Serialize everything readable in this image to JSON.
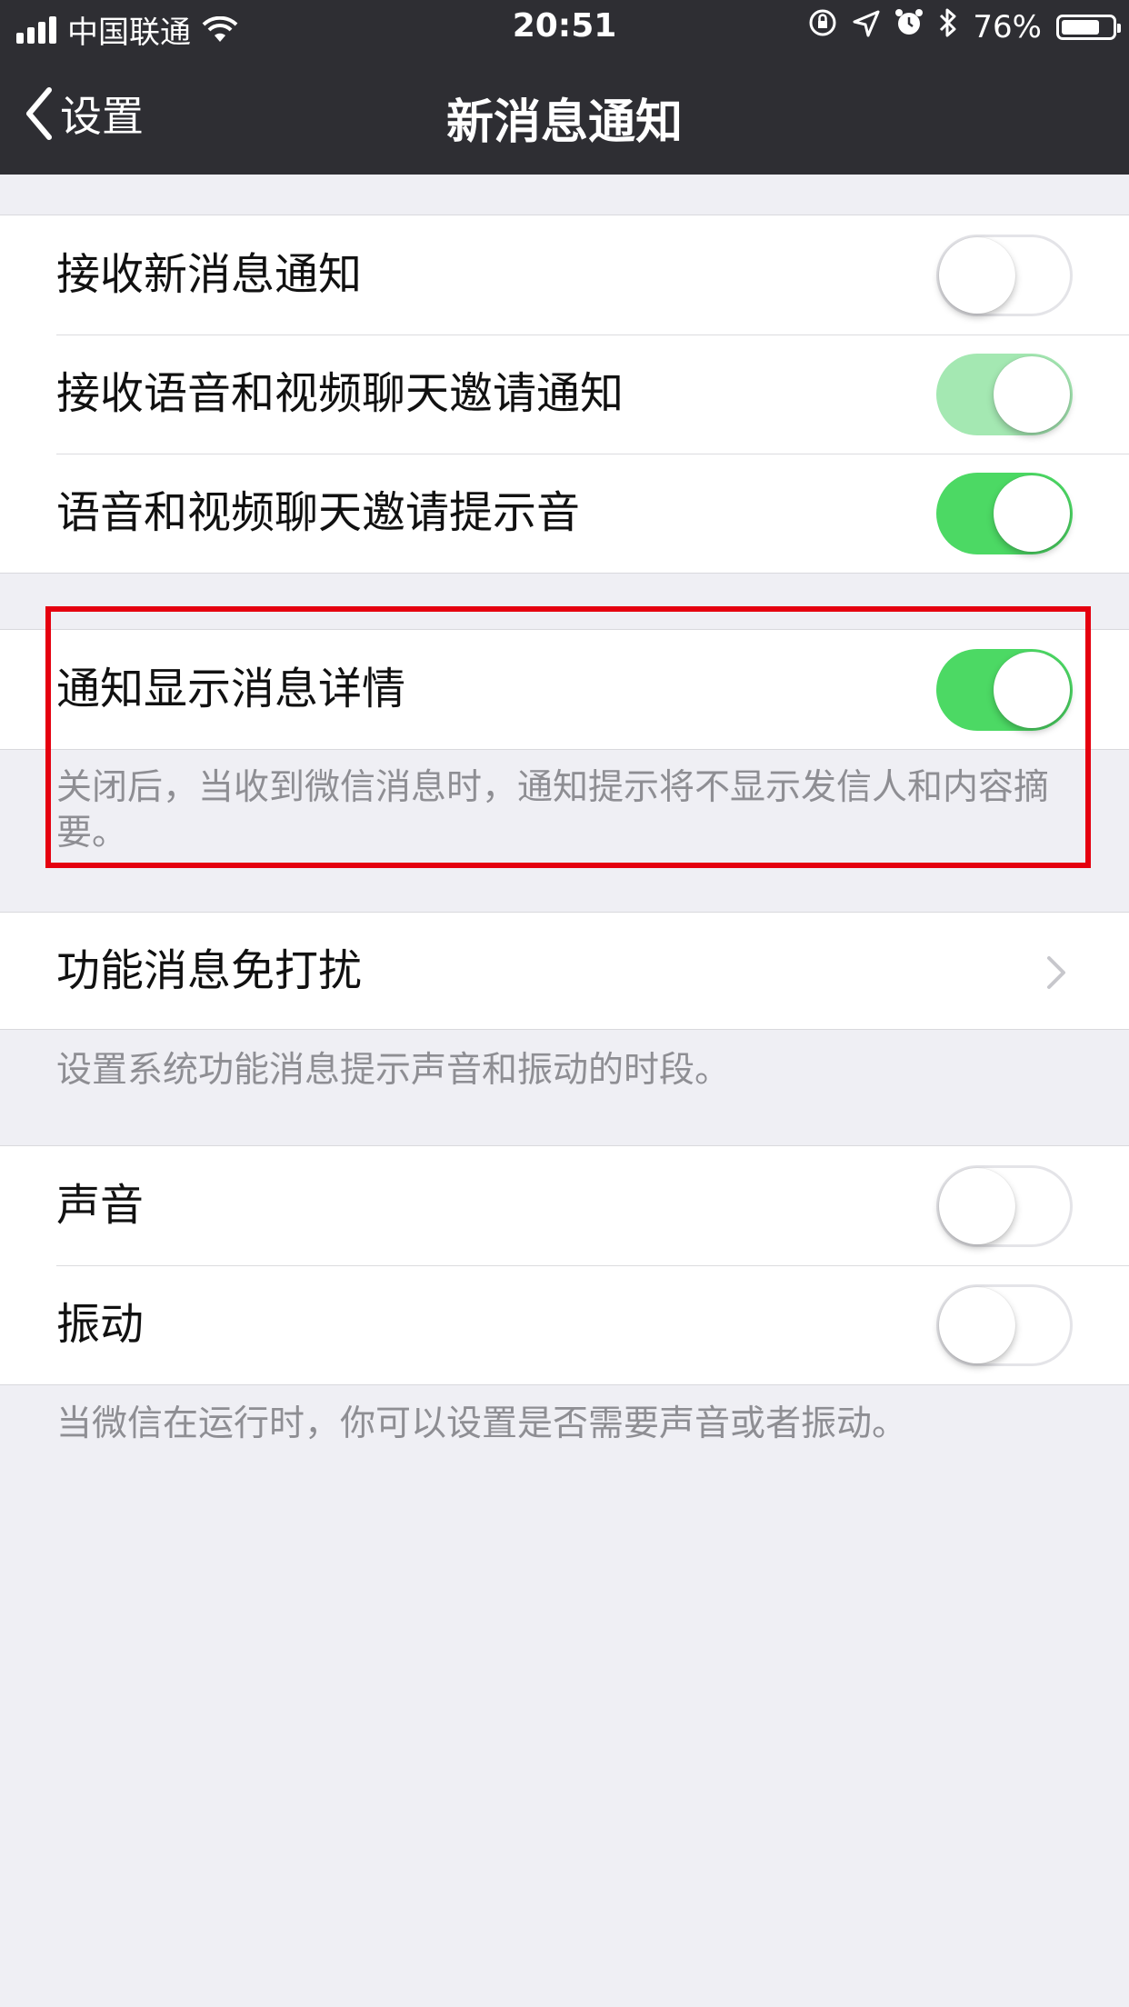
{
  "status_bar": {
    "carrier": "中国联通",
    "time": "20:51",
    "battery_percent": "76%",
    "battery_level": 0.76
  },
  "nav": {
    "back_label": "设置",
    "title": "新消息通知"
  },
  "groups": [
    {
      "rows": [
        {
          "label": "接收新消息通知",
          "switch_on": false
        },
        {
          "label": "接收语音和视频聊天邀请通知",
          "switch_on": true
        },
        {
          "label": "语音和视频聊天邀请提示音",
          "switch_on": true
        }
      ]
    },
    {
      "rows": [
        {
          "label": "通知显示消息详情",
          "switch_on": true
        }
      ],
      "note": "关闭后，当收到微信消息时，通知提示将不显示发信人和内容摘要。"
    },
    {
      "rows": [
        {
          "label": "功能消息免打扰",
          "type": "disclosure"
        }
      ],
      "note": "设置系统功能消息提示声音和振动的时段。"
    },
    {
      "rows": [
        {
          "label": "声音",
          "switch_on": false
        },
        {
          "label": "振动",
          "switch_on": false
        }
      ],
      "note": "当微信在运行时，你可以设置是否需要声音或者振动。"
    }
  ],
  "colors": {
    "nav_background": "#2e2e33",
    "switch_on": "#4cd964",
    "highlight_border": "#e5000f",
    "page_background": "#efeff4"
  }
}
